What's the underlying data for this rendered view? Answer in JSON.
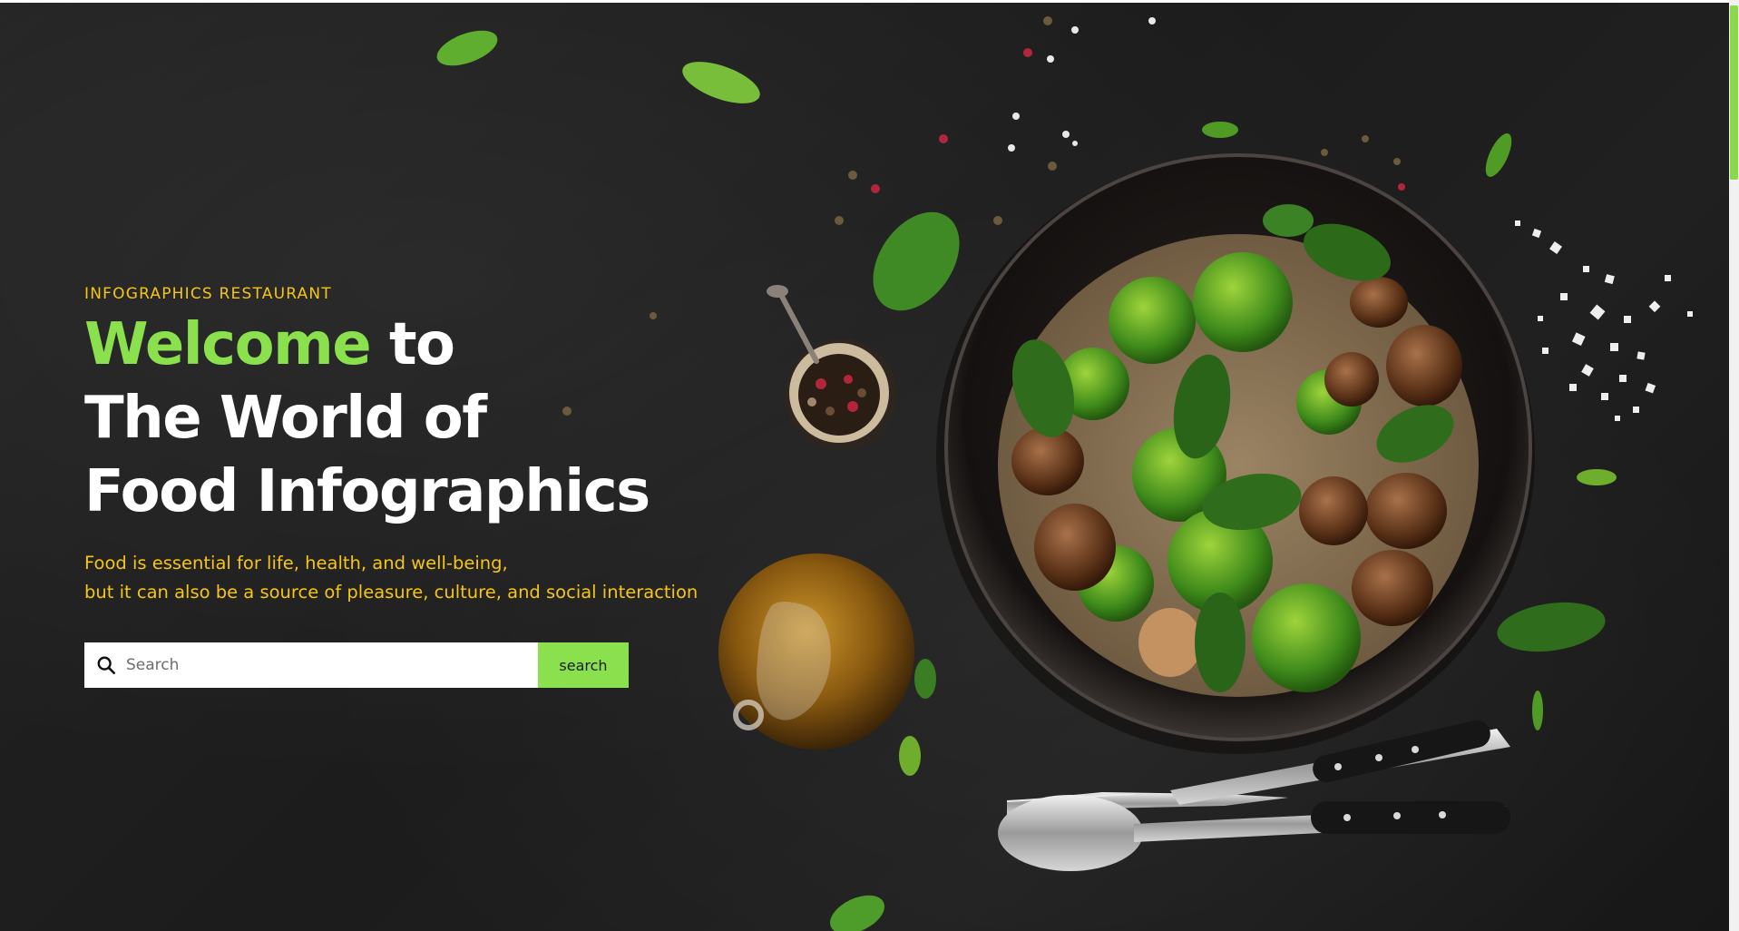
{
  "hero": {
    "eyebrow": "INFOGRAPHICS RESTAURANT",
    "headline": {
      "accent_word": "Welcome",
      "rest_line1": "to",
      "line2": "The World of",
      "line3": "Food Infographics"
    },
    "tagline": {
      "line1": "Food is essential for life, health, and well-being,",
      "line2": "but it can also be a source of pleasure, culture, and social interaction"
    }
  },
  "search": {
    "placeholder": "Search",
    "value": "",
    "button_label": "search",
    "icon": "search-icon"
  },
  "theme": {
    "background": "#1e1e1e",
    "accent_green": "#8be04e",
    "accent_yellow": "#f5c518",
    "heading_white": "#ffffff"
  },
  "illustration": {
    "subject": "food-photo",
    "icons": [
      "bowl-icon",
      "olive-oil-jar-icon",
      "peppercorn-pot-icon",
      "fork-icon",
      "spoon-icon",
      "basil-leaf-icon",
      "salt-crystals-icon"
    ]
  },
  "scrollbar": {
    "scroll_fraction": 0.0
  }
}
